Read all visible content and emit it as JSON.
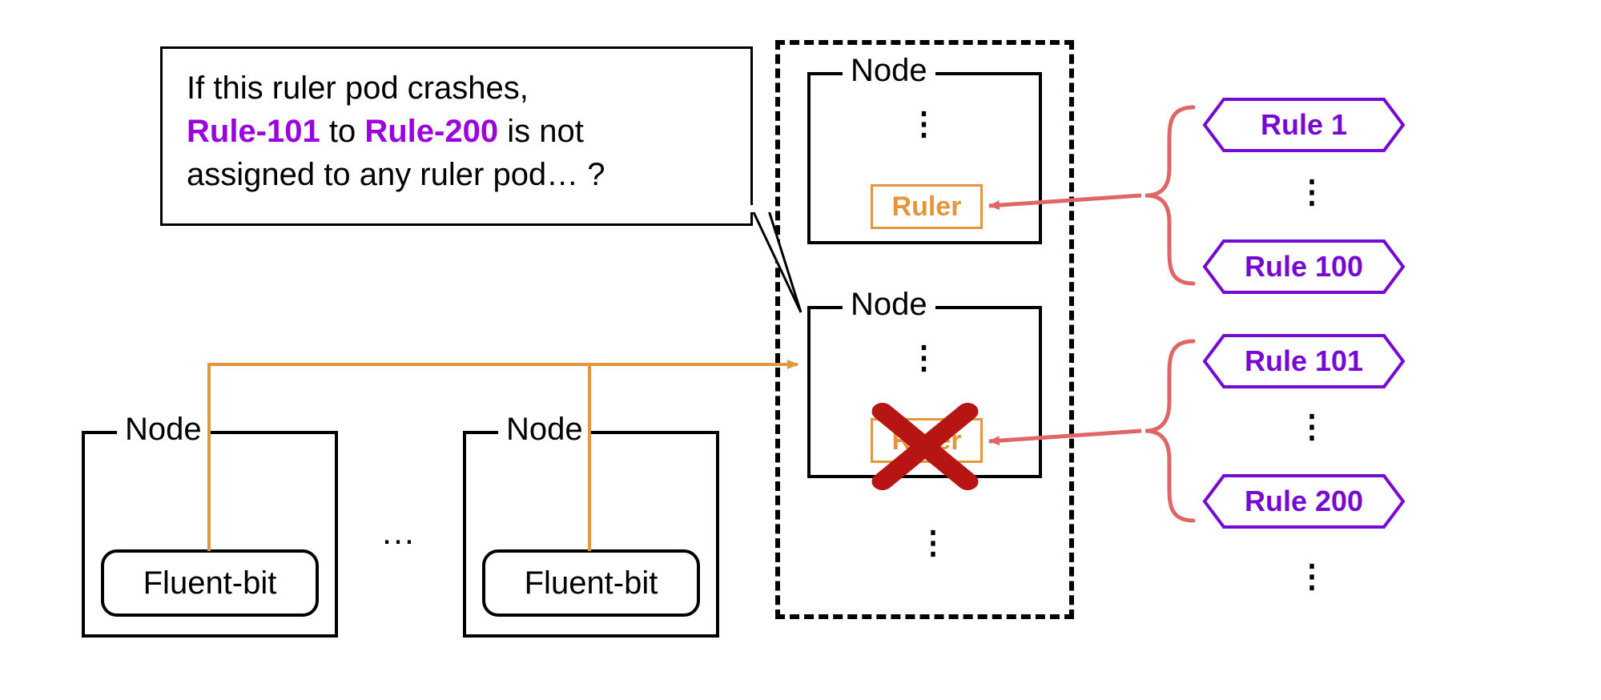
{
  "callout": {
    "line1": "If this ruler pod crashes,",
    "rule_start": "Rule-101",
    "mid": " to ",
    "rule_end": "Rule-200",
    "line2_tail": " is not",
    "line3": "assigned to any ruler pod… ?"
  },
  "nodes": {
    "fluent_left": {
      "title": "Node",
      "pod": "Fluent-bit"
    },
    "fluent_right": {
      "title": "Node",
      "pod": "Fluent-bit"
    },
    "ruler_top": {
      "title": "Node",
      "pod": "Ruler"
    },
    "ruler_bottom": {
      "title": "Node",
      "pod": "Ruler"
    }
  },
  "ellipsis": {
    "hdots": "…",
    "vdots": "⋮"
  },
  "rules": {
    "r1": "Rule 1",
    "r100": "Rule 100",
    "r101": "Rule 101",
    "r200": "Rule 200"
  },
  "colors": {
    "purple": "#9a02df",
    "purple_line": "#7609d3",
    "orange": "#e4963c",
    "ruler_color": "#e4963c",
    "red": "#b71414",
    "red_arrow": "#e06666"
  }
}
